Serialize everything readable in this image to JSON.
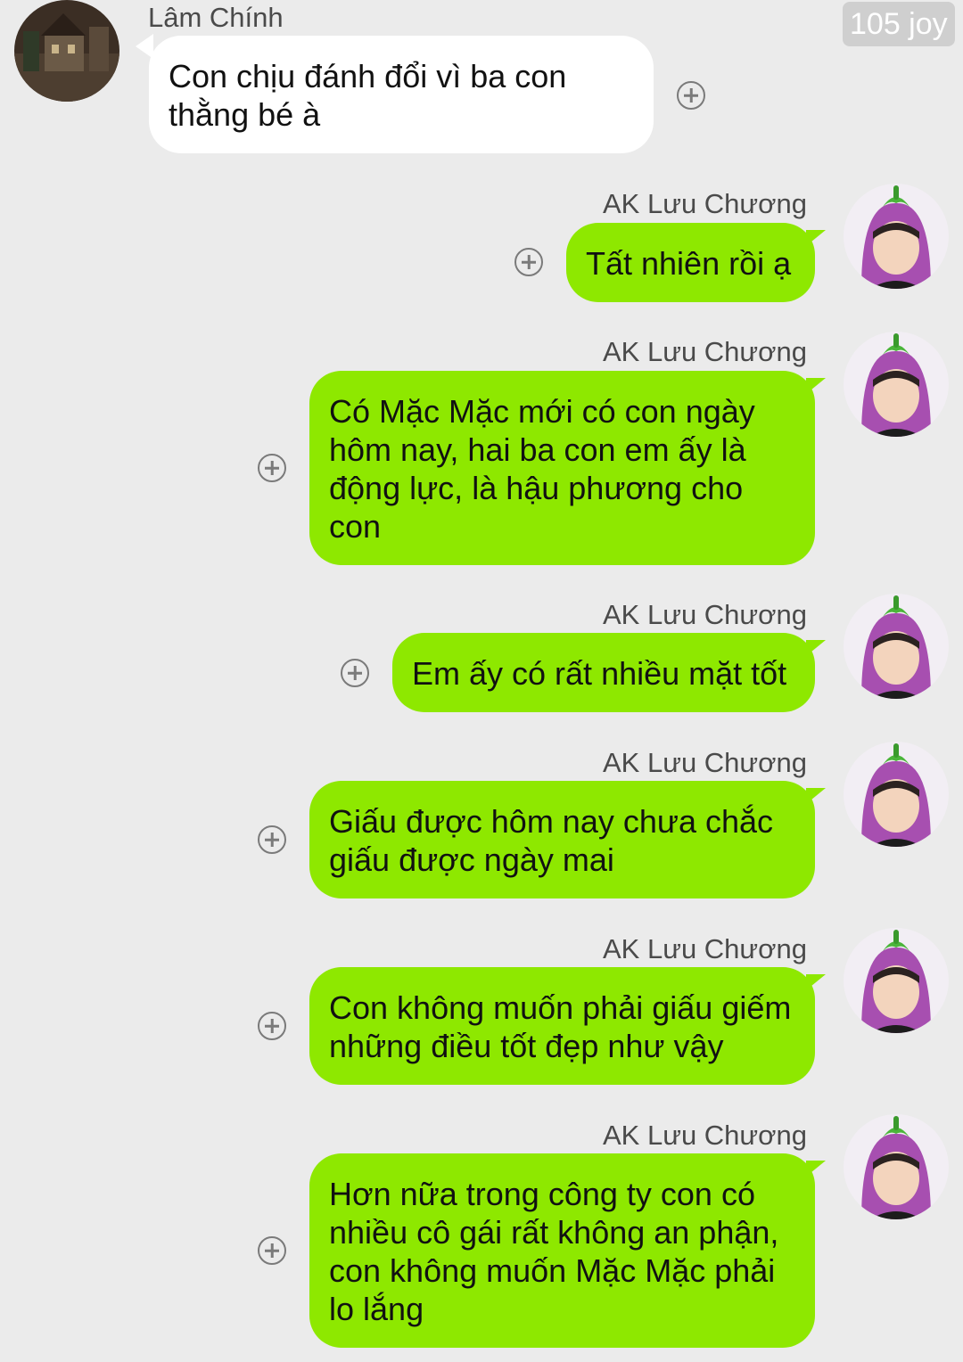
{
  "watermark": "105 joy",
  "messages": [
    {
      "sender": "Lâm Chính",
      "lines": [
        "Con chịu đánh đổi vì ba con",
        "thằng bé à"
      ]
    },
    {
      "sender": "AK Lưu Chương",
      "lines": [
        "Tất nhiên rồi ạ"
      ]
    },
    {
      "sender": "AK Lưu Chương",
      "lines": [
        "Có Mặc Mặc mới có con ngày",
        "hôm nay, hai ba con em ấy là",
        "động lực, là hậu phương cho",
        "con"
      ]
    },
    {
      "sender": "AK Lưu Chương",
      "lines": [
        "Em ấy có rất nhiều mặt tốt"
      ]
    },
    {
      "sender": "AK Lưu Chương",
      "lines": [
        "Giấu được hôm nay chưa chắc",
        "giấu được ngày mai"
      ]
    },
    {
      "sender": "AK Lưu Chương",
      "lines": [
        "Con không muốn phải giấu giếm",
        "những điều tốt đẹp như vậy"
      ]
    },
    {
      "sender": "AK Lưu Chương",
      "lines": [
        "Hơn nữa trong công ty con có",
        "nhiều cô gái rất không an phận,",
        "con không muốn Mặc Mặc phải",
        "lo lắng"
      ]
    }
  ],
  "colors": {
    "background": "#ebebeb",
    "incoming_bubble": "#ffffff",
    "outgoing_bubble": "#8ee800"
  },
  "icons": {
    "add": "plus-circle-icon"
  }
}
